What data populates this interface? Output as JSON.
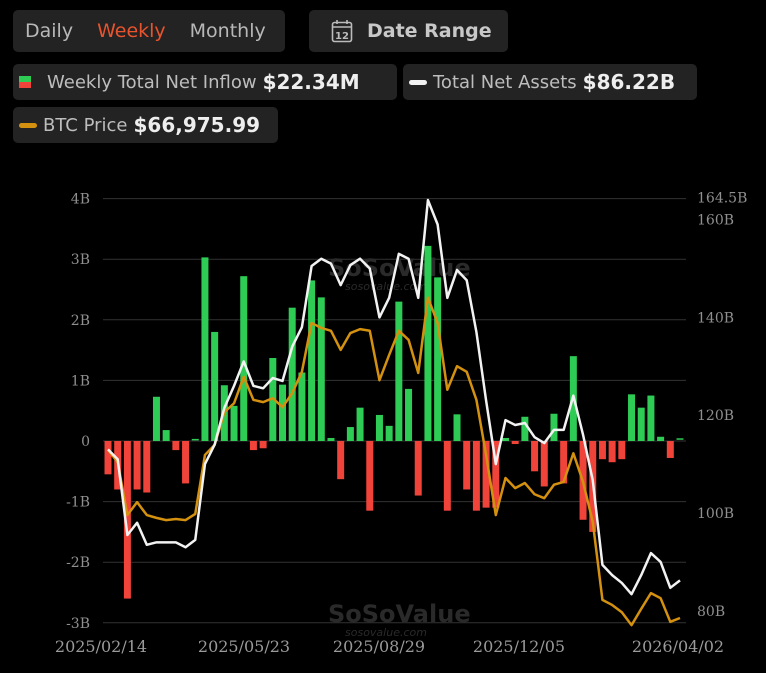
{
  "controls": {
    "tabs": [
      {
        "label": "Daily",
        "active": false
      },
      {
        "label": "Weekly",
        "active": true
      },
      {
        "label": "Monthly",
        "active": false
      }
    ],
    "date_range_label": "Date Range",
    "calendar_icon_day": "12"
  },
  "legend": {
    "inflow": {
      "label": "Weekly Total Net Inflow",
      "value": "$22.34M"
    },
    "assets": {
      "label": "Total Net Assets",
      "value": "$86.22B"
    },
    "btc": {
      "label": "BTC Price",
      "value": "$66,975.99"
    }
  },
  "colors": {
    "positive": "#2ecc55",
    "negative": "#f0433a",
    "assets": "#f2f2f2",
    "btc": "#d4910f",
    "active_tab": "#e9532d"
  },
  "watermark": {
    "brand": "SoSoValue",
    "url": "sosovalue.com"
  },
  "chart_data": {
    "type": "bar+line",
    "x_tick_labels": [
      "2025/02/14",
      "2025/05/23",
      "2025/08/29",
      "2025/12/05",
      "2026/04/02"
    ],
    "left_axis": {
      "ticks": [
        "4B",
        "3B",
        "2B",
        "1B",
        "0",
        "-1B",
        "-2B",
        "-3B"
      ],
      "range_billion": [
        -3,
        4
      ]
    },
    "right_axis": {
      "ticks": [
        "164.5B",
        "160B",
        "140B",
        "120B",
        "100B",
        "80B"
      ],
      "tick_values": [
        164.5,
        160,
        140,
        120,
        100,
        80
      ]
    },
    "series": [
      {
        "name": "Weekly Total Net Inflow",
        "type": "bar",
        "unit": "B USD",
        "values": [
          -0.55,
          -0.8,
          -2.6,
          -0.8,
          -0.85,
          0.73,
          0.18,
          -0.15,
          -0.7,
          0.01,
          3.03,
          1.8,
          0.92,
          0.58,
          2.72,
          -0.15,
          -0.12,
          1.37,
          0.93,
          2.2,
          1.13,
          2.65,
          2.37,
          0.05,
          -0.63,
          0.23,
          0.55,
          -1.15,
          0.43,
          0.25,
          2.3,
          0.86,
          -0.9,
          3.22,
          2.7,
          -1.15,
          0.44,
          -0.8,
          -1.15,
          -1.1,
          -1.1,
          0.05,
          -0.05,
          0.4,
          -0.5,
          -0.75,
          0.45,
          -0.7,
          1.4,
          -1.3,
          -1.5,
          -0.3,
          -0.35,
          -0.3,
          0.77,
          0.55,
          0.75,
          0.07,
          -0.28,
          0.02
        ]
      },
      {
        "name": "Total Net Assets",
        "type": "line",
        "unit": "B USD",
        "values": [
          113,
          111,
          95.5,
          98,
          93.5,
          94,
          94,
          94,
          93,
          94.5,
          110,
          114,
          121.5,
          126,
          131,
          126,
          125.5,
          127.6,
          127,
          134,
          138,
          150.5,
          152,
          151,
          146.6,
          150.7,
          152,
          150,
          140,
          144,
          153,
          152,
          144,
          164,
          159,
          144,
          149.7,
          147.6,
          137,
          123,
          110,
          119,
          118,
          118.4,
          115.5,
          114.3,
          117,
          117,
          124,
          116,
          106.7,
          89.4,
          87.3,
          85.7,
          83.4,
          87.3,
          91.8,
          90,
          84.7,
          86.22
        ]
      },
      {
        "name": "BTC Price",
        "type": "line",
        "unit": "USD",
        "values": [
          96900,
          94700,
          85300,
          87600,
          85300,
          84800,
          84400,
          84600,
          84400,
          85500,
          96000,
          97800,
          103600,
          105200,
          109900,
          105800,
          105400,
          106100,
          104500,
          107000,
          110800,
          119500,
          118600,
          118100,
          114700,
          117700,
          118400,
          118100,
          109300,
          113800,
          118100,
          116500,
          110600,
          124000,
          119500,
          107600,
          111800,
          110800,
          105800,
          96000,
          85300,
          91900,
          90100,
          91000,
          89000,
          88300,
          90700,
          91200,
          96300,
          91200,
          84100,
          70200,
          69300,
          68000,
          65700,
          68600,
          71400,
          70500,
          66300,
          66976
        ]
      }
    ]
  }
}
